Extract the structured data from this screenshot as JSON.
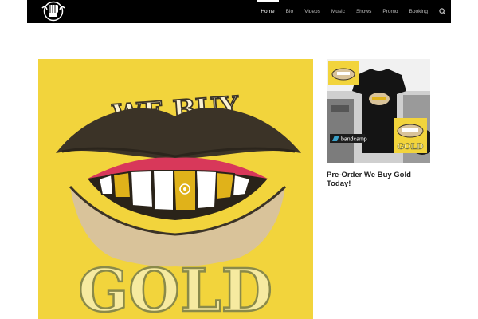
{
  "nav": {
    "items": [
      {
        "label": "Home",
        "active": true
      },
      {
        "label": "Bio",
        "active": false
      },
      {
        "label": "Videos",
        "active": false
      },
      {
        "label": "Music",
        "active": false
      },
      {
        "label": "Shows",
        "active": false
      },
      {
        "label": "Promo",
        "active": false
      },
      {
        "label": "Booking",
        "active": false
      }
    ],
    "search_icon": "search-icon",
    "logo_icon": "fist-logo-icon"
  },
  "hero": {
    "art_text_top": "WE BUY",
    "art_text_bottom": "GOLD"
  },
  "promo": {
    "bandcamp_label": "bandcamp",
    "title": "Pre-Order We Buy Gold Today!"
  },
  "colors": {
    "topbar": "#000000",
    "hero_bg": "#f2d43c",
    "lips": "#d9c39a",
    "gums": "#d8385a",
    "gold": "#e0b21a",
    "bandcamp": "#3aa0c8"
  }
}
